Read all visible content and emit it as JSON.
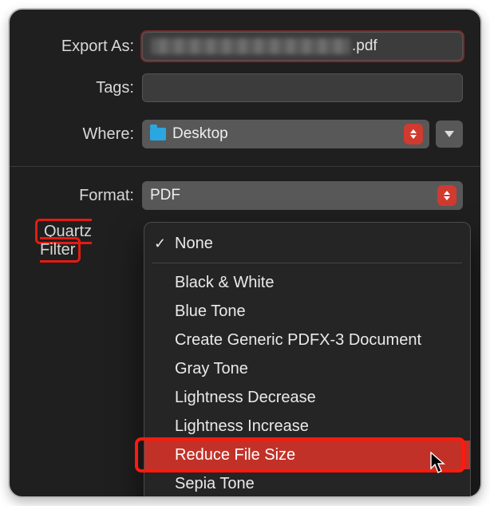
{
  "exportAs": {
    "label": "Export As:",
    "suffix": ".pdf"
  },
  "tags": {
    "label": "Tags:",
    "value": ""
  },
  "where": {
    "label": "Where:",
    "value": "Desktop"
  },
  "format": {
    "label": "Format:",
    "value": "PDF"
  },
  "quartz": {
    "label": "Quartz Filter"
  },
  "menu": {
    "selected": "None",
    "groups": [
      [
        "None"
      ],
      [
        "Black & White",
        "Blue Tone",
        "Create Generic PDFX-3 Document",
        "Gray Tone",
        "Lightness Decrease",
        "Lightness Increase",
        "Reduce File Size",
        "Sepia Tone"
      ]
    ],
    "hover": "Reduce File Size"
  }
}
